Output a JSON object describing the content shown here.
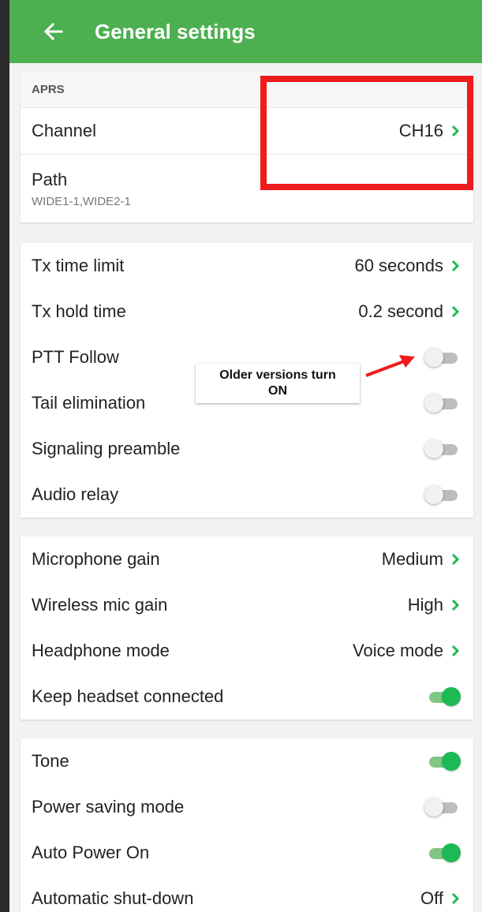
{
  "header": {
    "title": "General settings",
    "back_icon": "arrow-left-icon"
  },
  "aprs": {
    "header": "APRS",
    "channel": {
      "label": "Channel",
      "value": "CH16"
    },
    "path": {
      "label": "Path",
      "value": "WIDE1-1,WIDE2-1"
    }
  },
  "tx": {
    "tx_time_limit": {
      "label": "Tx time limit",
      "value": "60 seconds"
    },
    "tx_hold_time": {
      "label": "Tx hold time",
      "value": "0.2 second"
    },
    "ptt_follow": {
      "label": "PTT Follow",
      "on": false
    },
    "tail_elimination": {
      "label": "Tail elimination",
      "on": false
    },
    "signaling_preamble": {
      "label": "Signaling preamble",
      "on": false
    },
    "audio_relay": {
      "label": "Audio relay",
      "on": false
    }
  },
  "audio": {
    "microphone_gain": {
      "label": "Microphone gain",
      "value": "Medium"
    },
    "wireless_mic_gain": {
      "label": "Wireless mic gain",
      "value": "High"
    },
    "headphone_mode": {
      "label": "Headphone mode",
      "value": "Voice mode"
    },
    "keep_headset": {
      "label": "Keep headset connected",
      "on": true
    }
  },
  "power": {
    "tone": {
      "label": "Tone",
      "on": true
    },
    "power_saving": {
      "label": "Power saving mode",
      "on": false
    },
    "auto_power_on": {
      "label": "Auto Power On",
      "on": true
    },
    "auto_shutdown": {
      "label": "Automatic shut-down",
      "value": "Off"
    }
  },
  "annotation": {
    "note_line1": "Older versions turn",
    "note_line2": "ON"
  },
  "colors": {
    "accent": "#4caf50",
    "switch_on": "#1db954",
    "chevron": "#1db954",
    "annotation": "#ee1c1c"
  }
}
